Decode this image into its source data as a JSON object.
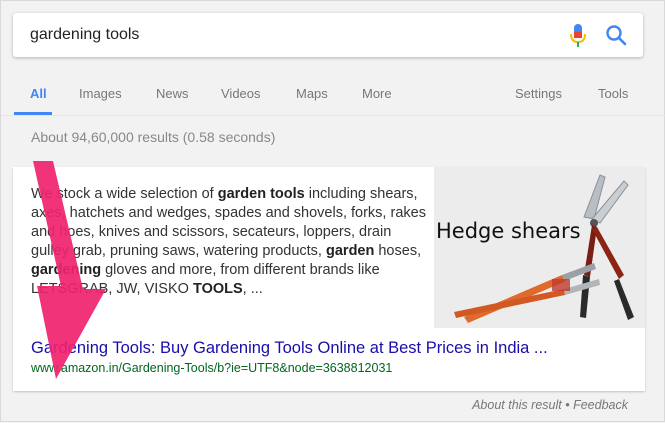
{
  "search": {
    "query": "gardening tools"
  },
  "tabs": [
    {
      "label": "All",
      "active": true
    },
    {
      "label": "Images"
    },
    {
      "label": "News"
    },
    {
      "label": "Videos"
    },
    {
      "label": "Maps"
    },
    {
      "label": "More"
    }
  ],
  "tools": {
    "settings": "Settings",
    "tools": "Tools"
  },
  "stats": "About 94,60,000 results (0.58 seconds)",
  "featured": {
    "snippet": [
      {
        "t": "We stock a wide selection of "
      },
      {
        "t": "garden tools",
        "b": true
      },
      {
        "t": " including shears, axes, hatchets and wedges, spades and shovels, forks, rakes and hoes, knives and scissors, secateurs, loppers, drain gulley grab, pruning saws, watering products, "
      },
      {
        "t": "garden",
        "b": true
      },
      {
        "t": " hoses, "
      },
      {
        "t": "gardening",
        "b": true
      },
      {
        "t": " gloves and more, from different brands like LETSGRAB, JW, VISKO "
      },
      {
        "t": "TOOLS",
        "b": true
      },
      {
        "t": ", ..."
      }
    ],
    "image_label": "Hedge shears",
    "title": "Gardening Tools: Buy Gardening Tools Online at Best Prices in India ...",
    "url": "www.amazon.in/Gardening-Tools/b?ie=UTF8&node=3638812031"
  },
  "footer": {
    "about": "About this result",
    "separator": "•",
    "feedback": "Feedback"
  },
  "colors": {
    "accent": "#4285f4",
    "link": "#1a0dab",
    "url": "#006621",
    "annotation": "#f0226e"
  }
}
